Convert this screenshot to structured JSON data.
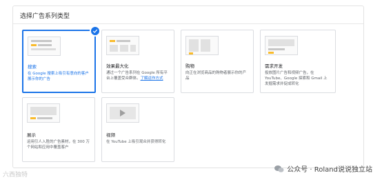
{
  "panel": {
    "title": "选择广告系列类型"
  },
  "cards": [
    {
      "name": "搜索",
      "desc": "在 Google 搜索上吸引有意向的客户展示你的广告",
      "link": "",
      "selected": true
    },
    {
      "name": "效果最大化",
      "desc": "通过一个广告系列在 Google 所有平台上覆盖受众群体。",
      "link": "了解运作方式",
      "selected": false
    },
    {
      "name": "购物",
      "desc": "向正在浏览商品的购物者展示你的产品",
      "link": "",
      "selected": false
    },
    {
      "name": "需求开发",
      "desc": "投放图片广告和视频广告，在 YouTube、Google 探索和 Gmail 上发掘需求并促成转化",
      "link": "",
      "selected": false
    },
    {
      "name": "展示",
      "desc": "运用引人入胜的广告素材，在 300 万个网站和应用中覆盖客户",
      "link": "",
      "selected": false
    },
    {
      "name": "视频",
      "desc": "在 YouTube 上吸引观众并获得转化",
      "link": "",
      "selected": false
    }
  ],
  "watermark": {
    "text": "公众号 · Roland说说独立站",
    "left_text": "六西独特"
  },
  "colors": {
    "accent": "#1a73e8",
    "yellow": "#f9bb2b"
  }
}
